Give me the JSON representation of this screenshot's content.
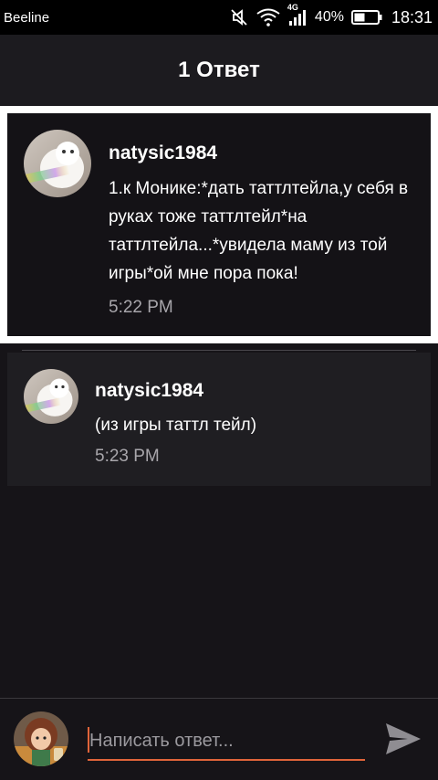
{
  "status_bar": {
    "carrier": "Beeline",
    "network": "4G",
    "battery_percent": "40%",
    "time": "18:31",
    "icons": [
      "mute-icon",
      "wifi-icon",
      "signal-icon",
      "battery-icon"
    ]
  },
  "header": {
    "title": "1 Ответ"
  },
  "comments": [
    {
      "username": "natysic1984",
      "text": "1.к Монике:*дать таттлтейла,у себя в руках тоже таттлтейл*на таттлтейла...*увидела маму из той игры*ой мне пора пока!",
      "time": "5:22 PM",
      "highlighted": true
    },
    {
      "username": "natysic1984",
      "text": "(из игры таттл тейл)",
      "time": "5:23 PM",
      "highlighted": false
    }
  ],
  "reply_bar": {
    "placeholder": "Написать ответ...",
    "value": "",
    "send_icon": "send-icon"
  },
  "colors": {
    "accent": "#e0643a",
    "background": "#161418",
    "header": "#1c1b1f",
    "timestamp": "#a8a6ab"
  }
}
